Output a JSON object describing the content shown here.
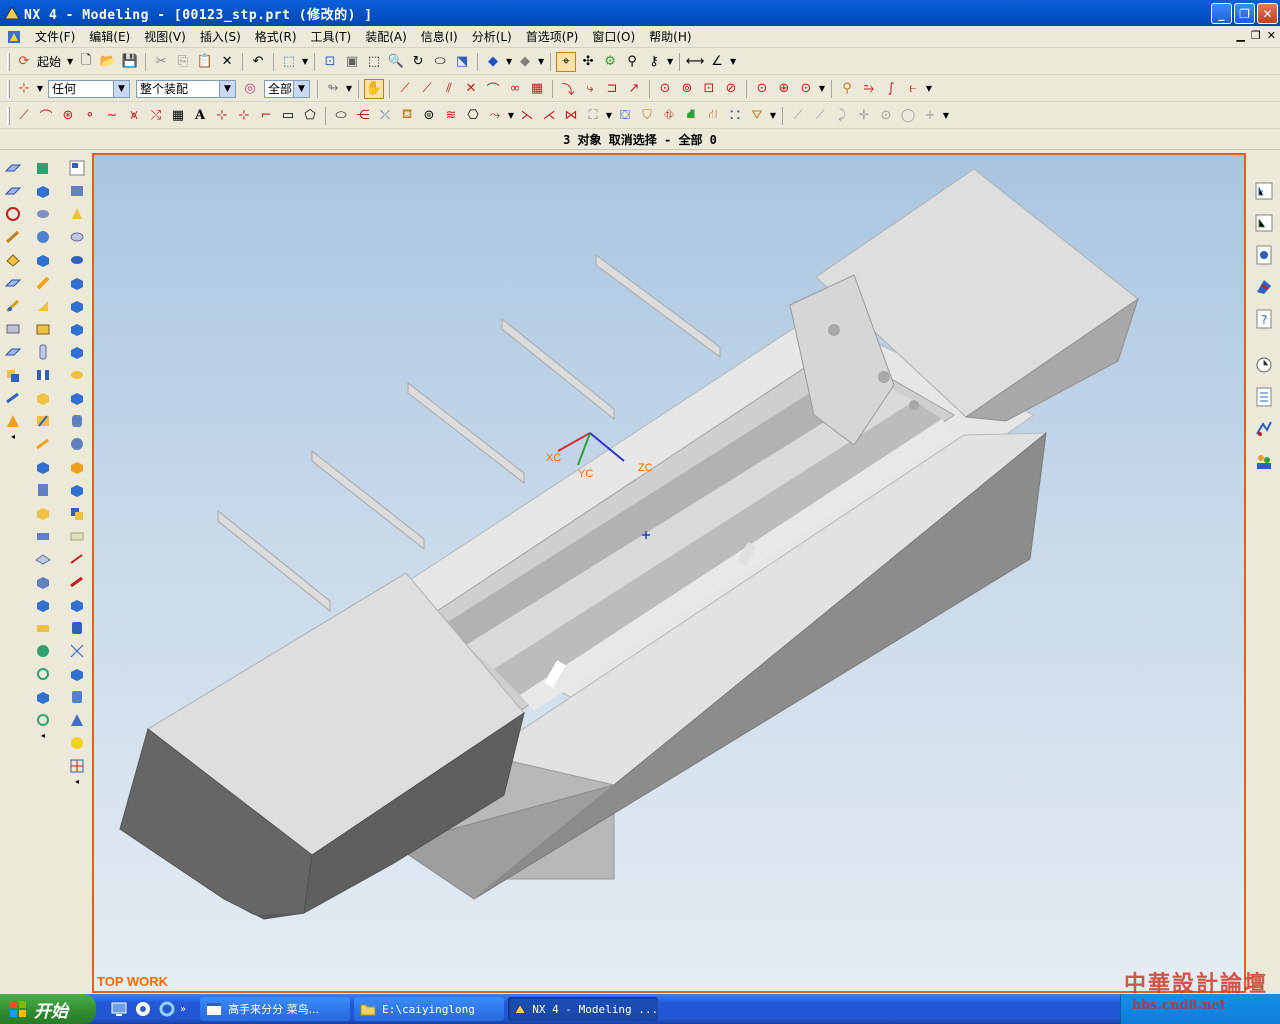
{
  "window": {
    "title": "NX 4 - Modeling - [00123_stp.prt  (修改的) ]"
  },
  "menu": {
    "items": [
      "文件(F)",
      "编辑(E)",
      "视图(V)",
      "插入(S)",
      "格式(R)",
      "工具(T)",
      "装配(A)",
      "信息(I)",
      "分析(L)",
      "首选项(P)",
      "窗口(O)",
      "帮助(H)"
    ]
  },
  "toolbar1": {
    "start_label": "起始"
  },
  "toolbar2": {
    "filter_value": "任何",
    "scope_value": "整个装配",
    "layer_value": "全部"
  },
  "status": {
    "message": "3 对象 取消选择  - 全部 0"
  },
  "viewport": {
    "view_label": "TOP WORK",
    "axes": {
      "x": "XC",
      "y": "YC",
      "z": "ZC"
    },
    "colors": {
      "x": "#d03030",
      "y": "#30a030",
      "z": "#3030d0",
      "label": "#ff6a00"
    }
  },
  "taskbar": {
    "start_label": "开始",
    "tasks": [
      {
        "label": "高手来分分 菜鸟..."
      },
      {
        "label": "E:\\caiyinglong"
      },
      {
        "label": "NX 4 - Modeling ..."
      }
    ]
  },
  "watermark": {
    "line1": "中華設計論壇",
    "line2": "bbs.cnd8.net"
  }
}
